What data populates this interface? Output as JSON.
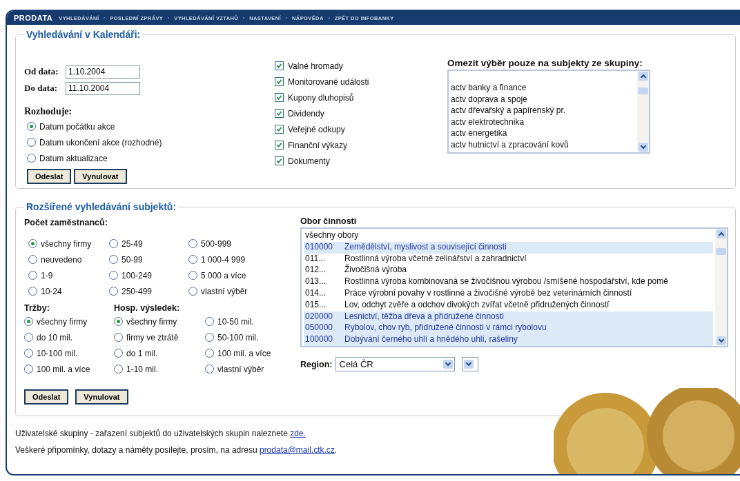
{
  "nav": {
    "brand": "PRODATA",
    "items": [
      "VYHLEDÁVÁNÍ",
      "POSLEDNÍ ZPRÁVY",
      "VYHLEDÁVÁNÍ VZTAHŮ",
      "NASTAVENÍ",
      "NÁPOVĚDA",
      "ZPĚT DO INFOBANKY"
    ]
  },
  "calendar": {
    "title": "Vyhledávání v Kalendáři:",
    "from_label": "Od data:",
    "from_value": "1.10.2004",
    "to_label": "Do data:",
    "to_value": "11.10.2004",
    "decides_label": "Rozhoduje:",
    "decides_options": [
      {
        "label": "Datum počátku akce",
        "selected": true
      },
      {
        "label": "Datum ukončení akce (rozhodné)",
        "selected": false
      },
      {
        "label": "Datum aktualizace",
        "selected": false
      }
    ],
    "buttons": [
      "Odeslat",
      "Vynulovat"
    ],
    "event_types": [
      {
        "label": "Valné hromady",
        "checked": true
      },
      {
        "label": "Monitorované události",
        "checked": true
      },
      {
        "label": "Kupony dluhopisů",
        "checked": true
      },
      {
        "label": "Dividendy",
        "checked": true
      },
      {
        "label": "Veřejné odkupy",
        "checked": true
      },
      {
        "label": "Finanční výkazy",
        "checked": true
      },
      {
        "label": "Dokumenty",
        "checked": true
      }
    ],
    "group_filter": {
      "label": "Omezit výběr pouze na subjekty ze skupiny:",
      "options": [
        "actv banky a finance",
        "actv doprava a spoje",
        "actv dřevařský a papírenský pr.",
        "actv elektrotechnika",
        "actv energetika",
        "actv hutnictví a zpracování kovů"
      ]
    }
  },
  "extended": {
    "title": "Rozšířené vyhledávání subjektů:",
    "employees": {
      "label": "Počet zaměstnanců:",
      "options": [
        {
          "label": "všechny firmy",
          "selected": true
        },
        {
          "label": "neuvedeno",
          "selected": false
        },
        {
          "label": "1-9",
          "selected": false
        },
        {
          "label": "10-24",
          "selected": false
        },
        {
          "label": "25-49",
          "selected": false
        },
        {
          "label": "50-99",
          "selected": false
        },
        {
          "label": "100-249",
          "selected": false
        },
        {
          "label": "250-499",
          "selected": false
        },
        {
          "label": "500-999",
          "selected": false
        },
        {
          "label": "1 000-4 999",
          "selected": false
        },
        {
          "label": "5 000 a více",
          "selected": false
        },
        {
          "label": "vlastní výběr",
          "selected": false
        }
      ]
    },
    "revenue": {
      "label": "Tržby:",
      "options": [
        {
          "label": "všechny firmy",
          "selected": true
        },
        {
          "label": "do 10 mil.",
          "selected": false
        },
        {
          "label": "10-100 mil.",
          "selected": false
        },
        {
          "label": "100 mil. a více",
          "selected": false
        }
      ]
    },
    "result": {
      "label": "Hosp. výsledek:",
      "options": [
        {
          "label": "všechny firmy",
          "selected": true
        },
        {
          "label": "firmy ve ztrátě",
          "selected": false
        },
        {
          "label": "do 1 mil.",
          "selected": false
        },
        {
          "label": "1-10 mil.",
          "selected": false
        },
        {
          "label": "10-50 mil.",
          "selected": false
        },
        {
          "label": "50-100 mil.",
          "selected": false
        },
        {
          "label": "100 mil. a více",
          "selected": false
        },
        {
          "label": "vlastní výběr",
          "selected": false
        }
      ]
    },
    "buttons": [
      "Odeslat",
      "Vynulovat"
    ],
    "activity": {
      "label": "Obor činnosti",
      "options": [
        {
          "kind": "all",
          "name": "všechny obory"
        },
        {
          "kind": "group",
          "code": "010000",
          "name": "Zemědělství, myslivost a související činnosti"
        },
        {
          "kind": "item",
          "code": "011...",
          "name": "Rostlinná výroba včetně zelinářství a zahradnictví"
        },
        {
          "kind": "item",
          "code": "012...",
          "name": "Živočišná výroba"
        },
        {
          "kind": "item",
          "code": "013...",
          "name": "Rostlinná výroba kombinovaná se živočišnou výrobou /smíšené hospodářství, kde pomě"
        },
        {
          "kind": "item",
          "code": "014...",
          "name": "Práce výrobní povahy v rostlinné a živočišné výrobě bez veterinárních činností"
        },
        {
          "kind": "item",
          "code": "015...",
          "name": "Lov, odchyt zvěře a odchov divokých zvířat včetně přidružených činností"
        },
        {
          "kind": "group",
          "code": "020000",
          "name": "Lesnictví, těžba dřeva a přidružené činnosti"
        },
        {
          "kind": "group",
          "code": "050000",
          "name": "Rybolov, chov ryb, přidružené činnosti v rámci rybolovu"
        },
        {
          "kind": "group",
          "code": "100000",
          "name": "Dobývání černého uhlí a hnědého uhlí, rašeliny"
        }
      ]
    },
    "region": {
      "label": "Region:",
      "value": "Celá ČR"
    }
  },
  "footer": [
    {
      "text": "Uživatelské skupiny - zařazení subjektů do uživatelských skupin naleznete",
      "link": "zde."
    },
    {
      "text": "Veškeré připomínky, dotazy a náměty posílejte, prosím, na adresu",
      "link": "prodata@mail.ctk.cz",
      "after": "."
    }
  ]
}
